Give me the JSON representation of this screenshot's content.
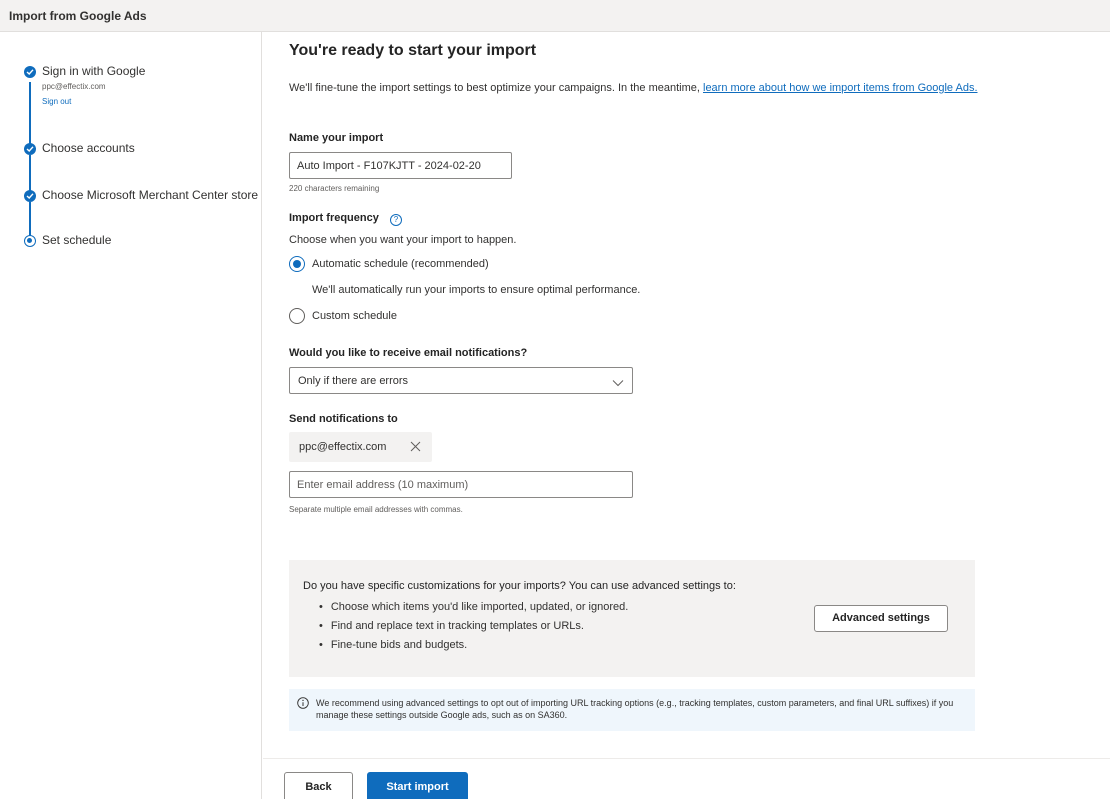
{
  "window": {
    "title": "Import from Google Ads"
  },
  "steps": [
    {
      "label": "Sign in with Google",
      "status": "done"
    },
    {
      "label": "Choose accounts",
      "status": "done"
    },
    {
      "label": "Choose Microsoft Merchant Center store",
      "status": "done"
    },
    {
      "label": "Set schedule",
      "status": "current"
    }
  ],
  "signin": {
    "email": "ppc@effectix.com",
    "signout_label": "Sign out"
  },
  "main": {
    "heading": "You're ready to start your import",
    "intro_text": "We'll fine-tune the import settings to best optimize your campaigns. In the meantime,",
    "intro_link": "learn more about how we import items from Google Ads."
  },
  "import_name": {
    "label": "Name your import",
    "value": "Auto Import - F107KJTT - 2024-02-20",
    "remaining": "220 characters remaining"
  },
  "frequency": {
    "label": "Import frequency",
    "help_icon": "?",
    "description": "Choose when you want your import to happen.",
    "options": [
      {
        "label": "Automatic schedule (recommended)",
        "checked": true
      },
      {
        "label": "Custom schedule",
        "checked": false
      }
    ],
    "automatic_note": "We'll automatically run your imports to ensure optimal performance."
  },
  "notifications": {
    "label": "Would you like to receive email notifications?",
    "selected": "Only if there are errors"
  },
  "send_to": {
    "label": "Send notifications to",
    "chip_email": "ppc@effectix.com",
    "placeholder": "Enter email address (10 maximum)",
    "hint": "Separate multiple email addresses with commas."
  },
  "advanced": {
    "question": "Do you have specific customizations for your imports? You can use advanced settings to:",
    "bullets": [
      "Choose which items you'd like imported, updated, or ignored.",
      "Find and replace text in tracking templates or URLs.",
      "Fine-tune bids and budgets."
    ],
    "button_label": "Advanced settings"
  },
  "info": {
    "icon": "info-icon",
    "text": "We recommend using advanced settings to opt out of importing URL tracking options (e.g., tracking templates, custom parameters, and final URL suffixes) if you manage these settings outside Google ads, such as on SA360."
  },
  "footer": {
    "back_label": "Back",
    "start_label": "Start import"
  },
  "colors": {
    "accent": "#0f6cbd",
    "panel": "#f3f2f1",
    "info_bg": "#eff6fc"
  }
}
